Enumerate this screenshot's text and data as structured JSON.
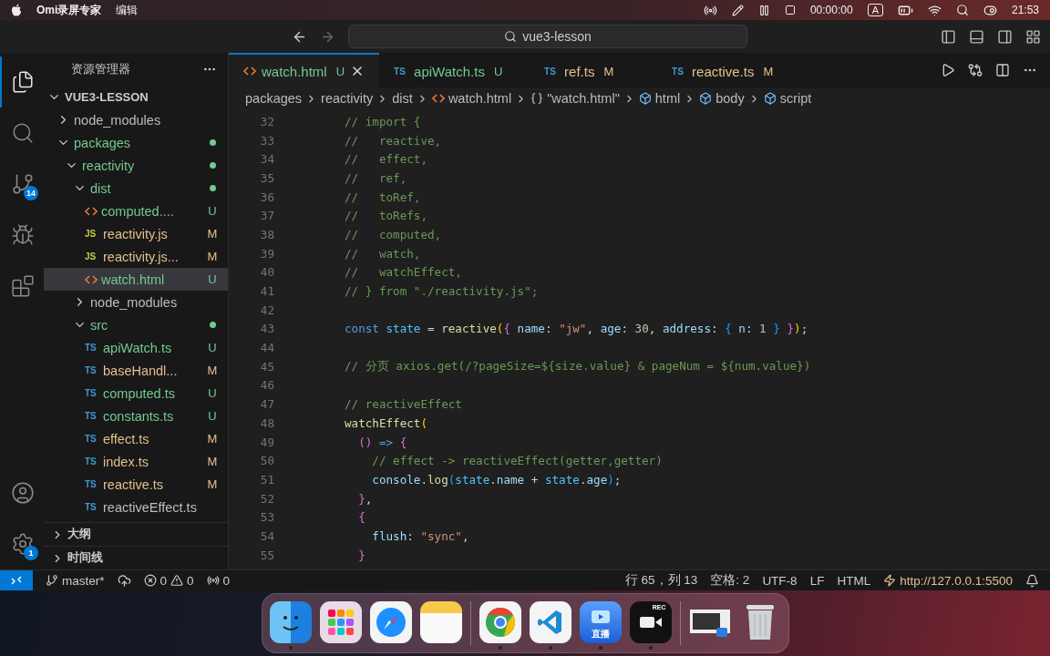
{
  "menu_bar": {
    "app": "Omi录屏专家",
    "menus": [
      "编辑"
    ],
    "timer": "00:00:00",
    "input_method": "A",
    "clock": "21:53"
  },
  "window": {
    "search": "vue3-lesson"
  },
  "activity_bar": {
    "items": [
      {
        "kind": "explorer",
        "selected": true
      },
      {
        "kind": "search",
        "selected": false
      },
      {
        "kind": "source-control",
        "selected": false,
        "badge": "14"
      },
      {
        "kind": "run",
        "selected": false
      },
      {
        "kind": "extensions",
        "selected": false
      }
    ],
    "bottom": [
      {
        "kind": "account"
      },
      {
        "kind": "settings",
        "badge": "1"
      }
    ]
  },
  "sidebar": {
    "title": "资源管理器",
    "root": {
      "label": "VUE3-LESSON",
      "expanded": true
    },
    "tree": [
      {
        "kind": "folder",
        "label": "node_modules",
        "expanded": false,
        "color": "#bdbdbd",
        "dot": false,
        "selected": false
      },
      {
        "kind": "folder",
        "label": "packages",
        "expanded": true,
        "color": "#73c991",
        "dot": true,
        "selected": false,
        "children": [
          {
            "kind": "folder",
            "label": "reactivity",
            "expanded": true,
            "color": "#73c991",
            "dot": true,
            "selected": false,
            "children": [
              {
                "kind": "folder",
                "label": "dist",
                "expanded": true,
                "color": "#73c991",
                "dot": true,
                "selected": false,
                "children": [
                  {
                    "kind": "html",
                    "label": "computed....",
                    "status": "U",
                    "color": "#73c991",
                    "selected": false
                  },
                  {
                    "kind": "js",
                    "type_label": "JS",
                    "label": "reactivity.js",
                    "status": "M",
                    "color": "#e2c08d",
                    "selected": false
                  },
                  {
                    "kind": "js",
                    "type_label": "JS",
                    "label": "reactivity.js...",
                    "status": "M",
                    "color": "#e2c08d",
                    "selected": false
                  },
                  {
                    "kind": "html",
                    "label": "watch.html",
                    "status": "U",
                    "color": "#73c991",
                    "selected": true
                  }
                ]
              },
              {
                "kind": "folder",
                "label": "node_modules",
                "expanded": false,
                "color": "#bdbdbd",
                "dot": false,
                "selected": false
              },
              {
                "kind": "folder",
                "label": "src",
                "expanded": true,
                "color": "#73c991",
                "dot": true,
                "selected": false,
                "children": [
                  {
                    "kind": "ts",
                    "type_label": "TS",
                    "label": "apiWatch.ts",
                    "status": "U",
                    "color": "#73c991",
                    "selected": false
                  },
                  {
                    "kind": "ts",
                    "type_label": "TS",
                    "label": "baseHandl...",
                    "status": "M",
                    "color": "#e2c08d",
                    "selected": false
                  },
                  {
                    "kind": "ts",
                    "type_label": "TS",
                    "label": "computed.ts",
                    "status": "U",
                    "color": "#73c991",
                    "selected": false
                  },
                  {
                    "kind": "ts",
                    "type_label": "TS",
                    "label": "constants.ts",
                    "status": "U",
                    "color": "#73c991",
                    "selected": false
                  },
                  {
                    "kind": "ts",
                    "type_label": "TS",
                    "label": "effect.ts",
                    "status": "M",
                    "color": "#e2c08d",
                    "selected": false
                  },
                  {
                    "kind": "ts",
                    "type_label": "TS",
                    "label": "index.ts",
                    "status": "M",
                    "color": "#e2c08d",
                    "selected": false
                  },
                  {
                    "kind": "ts",
                    "type_label": "TS",
                    "label": "reactive.ts",
                    "status": "M",
                    "color": "#e2c08d",
                    "selected": false
                  },
                  {
                    "kind": "ts",
                    "type_label": "TS",
                    "label": "reactiveEffect.ts",
                    "color": "#bdbdbd",
                    "selected": false
                  }
                ]
              }
            ]
          }
        ]
      }
    ],
    "sections": [
      {
        "label": "大纲",
        "expanded": false
      },
      {
        "label": "时间线",
        "expanded": false
      }
    ]
  },
  "tabs": [
    {
      "kind": "html",
      "label": "watch.html",
      "status": "U",
      "color": "#73c991",
      "selected": true
    },
    {
      "kind": "ts",
      "type_label": "TS",
      "label": "apiWatch.ts",
      "status": "U",
      "color": "#73c991",
      "selected": false
    },
    {
      "kind": "ts",
      "type_label": "TS",
      "label": "ref.ts",
      "status": "M",
      "color": "#e2c08d",
      "selected": false
    },
    {
      "kind": "ts",
      "type_label": "TS",
      "label": "reactive.ts",
      "status": "M",
      "color": "#e2c08d",
      "selected": false
    }
  ],
  "breadcrumbs": [
    {
      "kind": "folder",
      "label": "packages"
    },
    {
      "kind": "folder",
      "label": "reactivity"
    },
    {
      "kind": "folder",
      "label": "dist"
    },
    {
      "kind": "html",
      "label": "watch.html"
    },
    {
      "kind": "object",
      "label": "\"watch.html\""
    },
    {
      "kind": "element",
      "label": "html"
    },
    {
      "kind": "element",
      "label": "body"
    },
    {
      "kind": "element",
      "label": "script"
    }
  ],
  "editor": {
    "lines": [
      {
        "n": "32",
        "tokens": [
          {
            "kind": "comment",
            "t": "// import {"
          }
        ]
      },
      {
        "n": "33",
        "tokens": [
          {
            "kind": "comment",
            "t": "//   reactive,"
          }
        ]
      },
      {
        "n": "34",
        "tokens": [
          {
            "kind": "comment",
            "t": "//   effect,"
          }
        ]
      },
      {
        "n": "35",
        "tokens": [
          {
            "kind": "comment",
            "t": "//   ref,"
          }
        ]
      },
      {
        "n": "36",
        "tokens": [
          {
            "kind": "comment",
            "t": "//   toRef,"
          }
        ]
      },
      {
        "n": "37",
        "tokens": [
          {
            "kind": "comment",
            "t": "//   toRefs,"
          }
        ]
      },
      {
        "n": "38",
        "tokens": [
          {
            "kind": "comment",
            "t": "//   computed,"
          }
        ]
      },
      {
        "n": "39",
        "tokens": [
          {
            "kind": "comment",
            "t": "//   watch,"
          }
        ]
      },
      {
        "n": "40",
        "tokens": [
          {
            "kind": "comment",
            "t": "//   watchEffect,"
          }
        ]
      },
      {
        "n": "41",
        "tokens": [
          {
            "kind": "comment",
            "t": "// } from \"./reactivity.js\";"
          }
        ]
      },
      {
        "n": "42"
      },
      {
        "n": "43",
        "tokens": [
          {
            "kind": "keyword",
            "t": "const "
          },
          {
            "kind": "constant",
            "t": "state"
          },
          {
            "kind": "plain",
            "t": " = "
          },
          {
            "kind": "func",
            "t": "reactive"
          },
          {
            "kind": "bracket1",
            "t": "("
          },
          {
            "kind": "bracket2",
            "t": "{"
          },
          {
            "kind": "prop",
            "t": " name"
          },
          {
            "kind": "plain",
            "t": ": "
          },
          {
            "kind": "string",
            "t": "\"jw\""
          },
          {
            "kind": "plain",
            "t": ", "
          },
          {
            "kind": "prop",
            "t": "age"
          },
          {
            "kind": "plain",
            "t": ": "
          },
          {
            "kind": "number",
            "t": "30"
          },
          {
            "kind": "plain",
            "t": ", "
          },
          {
            "kind": "prop",
            "t": "address"
          },
          {
            "kind": "plain",
            "t": ": "
          },
          {
            "kind": "bracket3",
            "t": "{"
          },
          {
            "kind": "prop",
            "t": " n"
          },
          {
            "kind": "plain",
            "t": ": "
          },
          {
            "kind": "number",
            "t": "1 "
          },
          {
            "kind": "bracket3",
            "t": "} "
          },
          {
            "kind": "bracket2",
            "t": "}"
          },
          {
            "kind": "bracket1",
            "t": ")"
          },
          {
            "kind": "plain",
            "t": ";"
          }
        ]
      },
      {
        "n": "44"
      },
      {
        "n": "45",
        "tokens": [
          {
            "kind": "comment",
            "t": "// 分页 axios.get(/?pageSize=${size.value} & pageNum = ${num.value})"
          }
        ]
      },
      {
        "n": "46"
      },
      {
        "n": "47",
        "tokens": [
          {
            "kind": "comment",
            "t": "// reactiveEffect"
          }
        ]
      },
      {
        "n": "48",
        "tokens": [
          {
            "kind": "func",
            "t": "watchEffect"
          },
          {
            "kind": "bracket1",
            "t": "("
          }
        ]
      },
      {
        "n": "49",
        "tokens": [
          {
            "kind": "bracket2",
            "t": "  () "
          },
          {
            "kind": "keyword",
            "t": "=> "
          },
          {
            "kind": "bracket2",
            "t": "{"
          }
        ]
      },
      {
        "n": "50",
        "tokens": [
          {
            "kind": "comment",
            "t": "    // effect -> reactiveEffect(getter,getter)"
          }
        ]
      },
      {
        "n": "51",
        "tokens": [
          {
            "kind": "prop",
            "t": "    console"
          },
          {
            "kind": "plain",
            "t": "."
          },
          {
            "kind": "func",
            "t": "log"
          },
          {
            "kind": "bracket3",
            "t": "("
          },
          {
            "kind": "constant",
            "t": "state"
          },
          {
            "kind": "plain",
            "t": "."
          },
          {
            "kind": "prop",
            "t": "name"
          },
          {
            "kind": "plain",
            "t": " + "
          },
          {
            "kind": "constant",
            "t": "state"
          },
          {
            "kind": "plain",
            "t": "."
          },
          {
            "kind": "prop",
            "t": "age"
          },
          {
            "kind": "bracket3",
            "t": ")"
          },
          {
            "kind": "plain",
            "t": ";"
          }
        ]
      },
      {
        "n": "52",
        "tokens": [
          {
            "kind": "bracket2",
            "t": "  }"
          },
          {
            "kind": "plain",
            "t": ","
          }
        ]
      },
      {
        "n": "53",
        "tokens": [
          {
            "kind": "bracket2",
            "t": "  {"
          }
        ]
      },
      {
        "n": "54",
        "tokens": [
          {
            "kind": "prop",
            "t": "    flush"
          },
          {
            "kind": "plain",
            "t": ": "
          },
          {
            "kind": "string",
            "t": "\"sync\""
          },
          {
            "kind": "plain",
            "t": ","
          }
        ]
      },
      {
        "n": "55",
        "tokens": [
          {
            "kind": "bracket2",
            "t": "  }"
          }
        ]
      }
    ]
  },
  "status_bar": {
    "branch": "master*",
    "errors": "0",
    "warnings": "0",
    "ports": "0",
    "right": [
      "行 65，列 13",
      "空格: 2",
      "UTF-8",
      "LF",
      "HTML"
    ],
    "live_server": "http://127.0.0.1:5500"
  },
  "dock": [
    {
      "kind": "finder",
      "running": true
    },
    {
      "kind": "launchpad",
      "running": false
    },
    {
      "kind": "safari",
      "running": false
    },
    {
      "kind": "notes",
      "running": false
    },
    {
      "kind": "separator"
    },
    {
      "kind": "chrome",
      "running": true
    },
    {
      "kind": "vscode",
      "running": true
    },
    {
      "kind": "live",
      "label": "直播",
      "running": true
    },
    {
      "kind": "recorder",
      "label": "REC",
      "running": true
    },
    {
      "kind": "separator"
    },
    {
      "kind": "screenshot",
      "running": false
    },
    {
      "kind": "trash",
      "running": false
    }
  ]
}
